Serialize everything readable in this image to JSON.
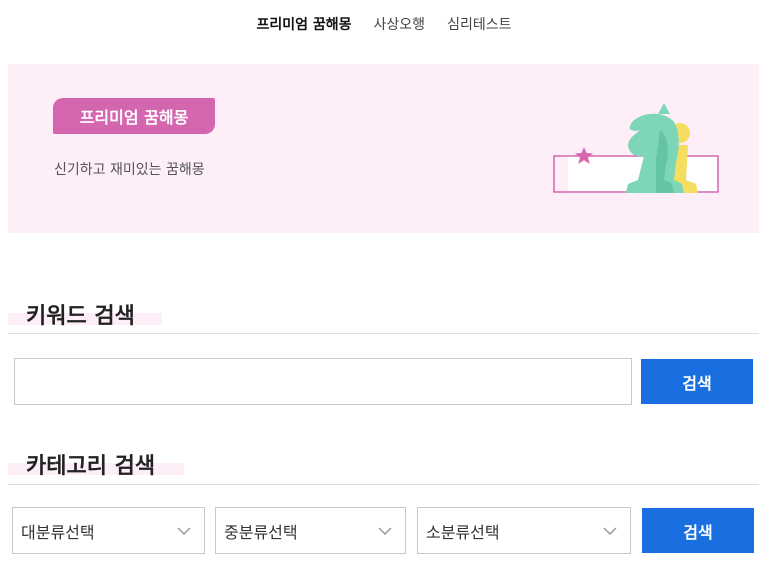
{
  "nav": {
    "items": [
      {
        "label": "프리미엄 꿈해몽",
        "active": true
      },
      {
        "label": "사상오행",
        "active": false
      },
      {
        "label": "심리테스트",
        "active": false
      }
    ]
  },
  "banner": {
    "badge": "프리미엄 꿈해몽",
    "subtitle": "신기하고 재미있는 꿈해몽",
    "colors": {
      "background": "#fdeef8",
      "badge": "#d466b0",
      "horse": "#7dd6b8",
      "pawn": "#f5dd62",
      "star": "#d466b0"
    }
  },
  "keyword_search": {
    "title": "키워드 검색",
    "input_value": "",
    "placeholder": "",
    "button": "검색"
  },
  "category_search": {
    "title": "카테고리 검색",
    "selects": [
      {
        "label": "대분류선택"
      },
      {
        "label": "중분류선택"
      },
      {
        "label": "소분류선택"
      }
    ],
    "button": "검색"
  },
  "colors": {
    "primary_button": "#1a6fe0",
    "divider": "#dddddd"
  }
}
